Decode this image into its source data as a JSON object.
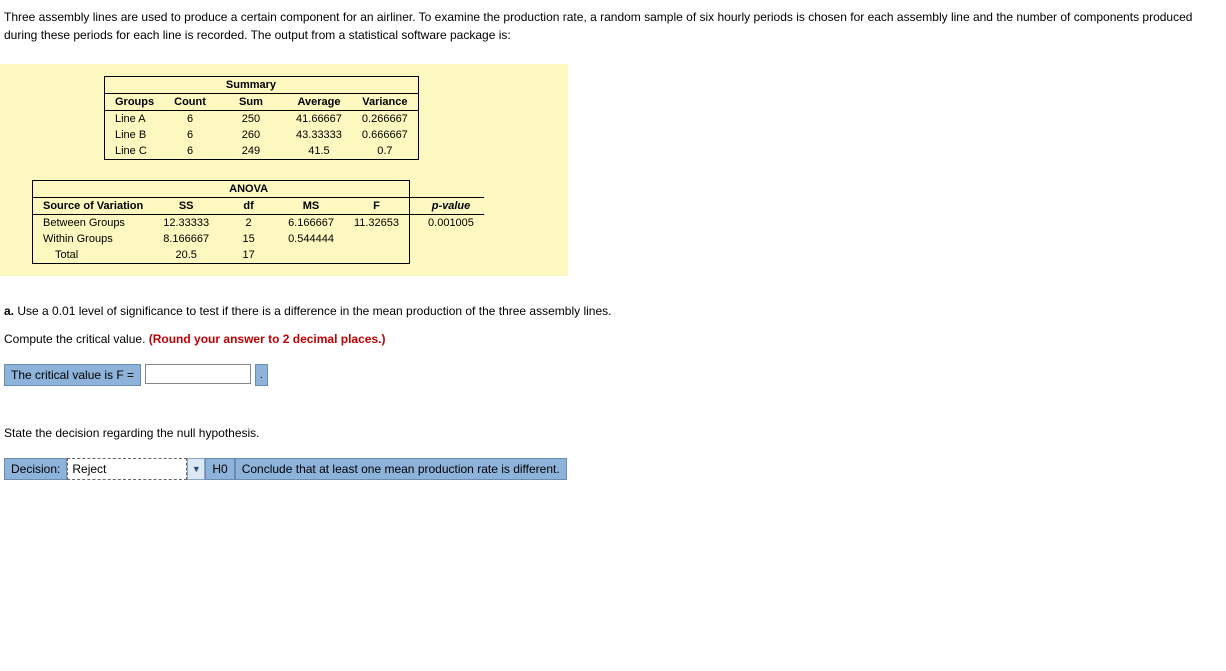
{
  "intro": "Three assembly lines are used to produce a certain component for an airliner. To examine the production rate, a random sample of six hourly periods is chosen for each assembly line and the number of components produced during these periods for each line is recorded. The output from a statistical software package is:",
  "summary": {
    "title": "Summary",
    "headers": {
      "groups": "Groups",
      "count": "Count",
      "sum": "Sum",
      "average": "Average",
      "variance": "Variance"
    },
    "rows": [
      {
        "group": "Line A",
        "count": "6",
        "sum": "250",
        "average": "41.66667",
        "variance": "0.266667"
      },
      {
        "group": "Line B",
        "count": "6",
        "sum": "260",
        "average": "43.33333",
        "variance": "0.666667"
      },
      {
        "group": "Line C",
        "count": "6",
        "sum": "249",
        "average": "41.5",
        "variance": "0.7"
      }
    ]
  },
  "anova": {
    "title": "ANOVA",
    "headers": {
      "source": "Source of Variation",
      "ss": "SS",
      "df": "df",
      "ms": "MS",
      "f": "F",
      "pvalue": "p-value"
    },
    "rows": [
      {
        "source": "Between Groups",
        "ss": "12.33333",
        "df": "2",
        "ms": "6.166667",
        "f": "11.32653",
        "p": "0.001005"
      },
      {
        "source": "Within Groups",
        "ss": "8.166667",
        "df": "15",
        "ms": "0.544444",
        "f": "",
        "p": ""
      },
      {
        "source": "Total",
        "ss": "20.5",
        "df": "17",
        "ms": "",
        "f": "",
        "p": ""
      }
    ]
  },
  "part_a": {
    "label": "a.",
    "text": " Use a 0.01 level of significance to test if there is a difference in the mean production of the three assembly lines."
  },
  "compute_line": {
    "text": "Compute the critical value. ",
    "hint": "(Round your answer to 2 decimal places.)"
  },
  "critical": {
    "label": "The critical value is F =",
    "period": "."
  },
  "state_text": "State the decision regarding the null hypothesis.",
  "decision": {
    "label": "Decision:",
    "value": "Reject",
    "h0": "H0",
    "conclusion": "Conclude that at least one mean production rate is different."
  }
}
